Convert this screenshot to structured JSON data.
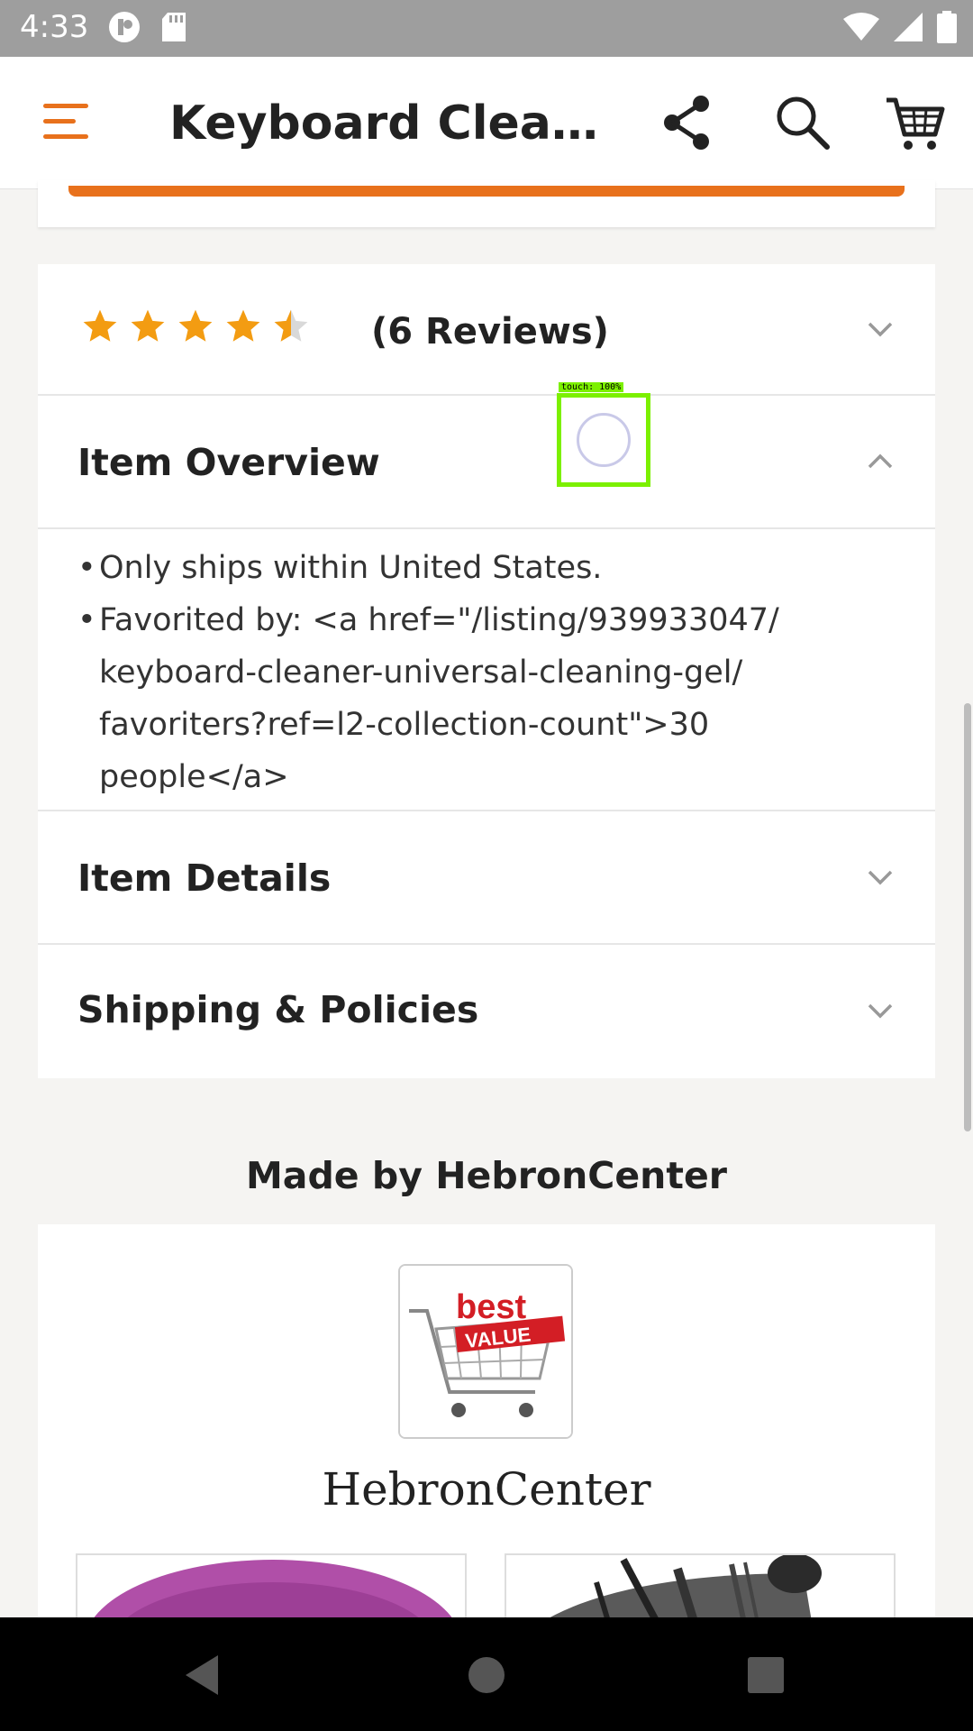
{
  "status_bar": {
    "time": "4:33",
    "icons": [
      "notification-app-icon",
      "sd-card-icon",
      "wifi-icon",
      "signal-icon",
      "battery-icon"
    ]
  },
  "app_bar": {
    "title": "Keyboard Cleane...",
    "icons": [
      "menu-icon",
      "share-icon",
      "search-icon",
      "cart-icon"
    ],
    "accent": "#e8711c"
  },
  "reviews": {
    "rating": 4.5,
    "max_rating": 5,
    "label": "(6 Reviews)",
    "star_color": "#f39c12"
  },
  "sections": {
    "overview": {
      "title": "Item Overview",
      "bullets": [
        "Only ships within United States.",
        "Favorited by: <a href=\"/listing/939933047/",
        "keyboard-cleaner-universal-cleaning-gel/",
        "favoriters?ref=l2-collection-count\">30 people</a>"
      ]
    },
    "details": {
      "title": "Item Details"
    },
    "shipping": {
      "title": "Shipping & Policies"
    }
  },
  "shop": {
    "made_by": "Made by HebronCenter",
    "name": "HebronCenter",
    "logo_text": "best VALUE"
  },
  "overlay": {
    "touch_label": "touch: 100%"
  }
}
